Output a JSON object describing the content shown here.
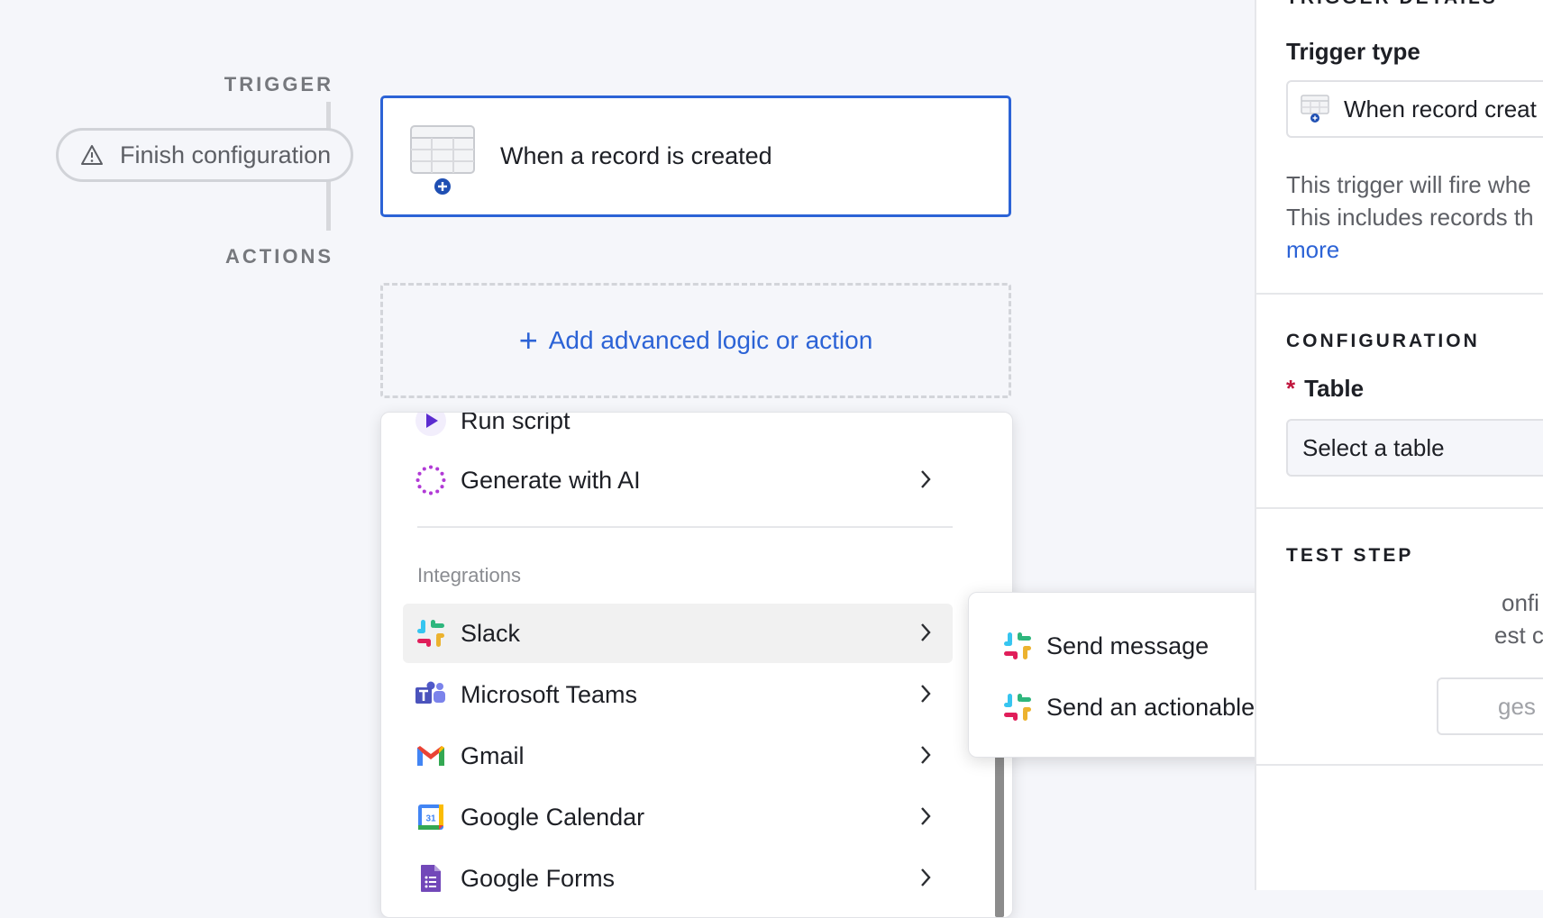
{
  "workflow": {
    "trigger_label": "TRIGGER",
    "actions_label": "ACTIONS",
    "finish_config_label": "Finish configuration",
    "trigger_card_title": "When a record is created",
    "add_action_label": "Add advanced logic or action"
  },
  "action_menu": {
    "partial_item_label": "Run script",
    "ai_item_label": "Generate with AI",
    "integrations_heading": "Integrations",
    "integrations": [
      {
        "label": "Slack",
        "icon": "slack-icon",
        "active": true
      },
      {
        "label": "Microsoft Teams",
        "icon": "microsoft-teams-icon"
      },
      {
        "label": "Gmail",
        "icon": "gmail-icon"
      },
      {
        "label": "Google Calendar",
        "icon": "google-calendar-icon",
        "icon_text": "31"
      },
      {
        "label": "Google Forms",
        "icon": "google-forms-icon"
      }
    ]
  },
  "slack_submenu": {
    "items": [
      {
        "label": "Send message",
        "icon": "slack-icon"
      },
      {
        "label": "Send an actionable message",
        "icon": "slack-icon"
      }
    ]
  },
  "side_panel": {
    "trigger_details_heading": "TRIGGER DETAILS",
    "trigger_type_label": "Trigger type",
    "trigger_type_value": "When record creat",
    "description_line1": "This trigger will fire whe",
    "description_line2": "This includes records th",
    "learn_more_link": "more",
    "configuration_heading": "CONFIGURATION",
    "required_marker": "*",
    "table_label": "Table",
    "table_placeholder": "Select a table",
    "test_step_heading": "TEST STEP",
    "partial_text_1": "onfi",
    "partial_text_2": "est c",
    "partial_text_3": "ges"
  },
  "colors": {
    "accent_blue": "#2c63d6",
    "required_red": "#c0143c",
    "background": "#f5f6fa"
  }
}
